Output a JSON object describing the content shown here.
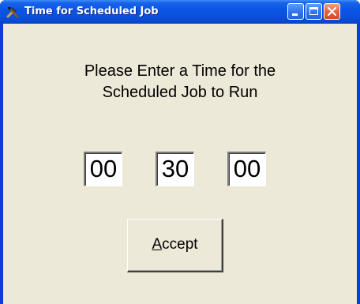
{
  "window": {
    "title": "Time for Scheduled Job",
    "icon": "tools-icon",
    "controls": {
      "minimize": "minimize-icon",
      "maximize": "maximize-icon",
      "close": "close-icon"
    }
  },
  "prompt": {
    "line1": "Please Enter a Time for the",
    "line2": "Scheduled Job to Run"
  },
  "time": {
    "hours": "00",
    "minutes": "30",
    "seconds": "00"
  },
  "accept_button": {
    "accel_letter": "A",
    "rest": "ccept"
  },
  "colors": {
    "titlebar": "#0a55e6",
    "client_bg": "#ece9d8",
    "close_button": "#e2643f"
  }
}
